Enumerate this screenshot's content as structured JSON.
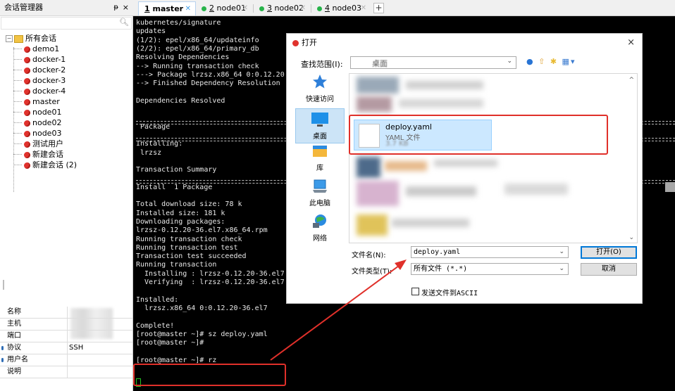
{
  "sidebar": {
    "title": "会话管理器",
    "pin_label": "ᵽ",
    "close_label": "×",
    "root": "所有会话",
    "sessions": [
      "demo1",
      "docker-1",
      "docker-2",
      "docker-3",
      "docker-4",
      "master",
      "node01",
      "node02",
      "node03",
      "测试用户",
      "新建会话",
      "新建会话 (2)"
    ],
    "properties": [
      {
        "key": "名称",
        "value": ""
      },
      {
        "key": "主机",
        "value": ""
      },
      {
        "key": "端口",
        "value": ""
      },
      {
        "key": "协议",
        "value": "SSH"
      },
      {
        "key": "用户名",
        "value": ""
      },
      {
        "key": "说明",
        "value": ""
      }
    ]
  },
  "tabs": [
    {
      "num": "1",
      "name": "master",
      "active": true
    },
    {
      "num": "2",
      "name": "node01",
      "active": false
    },
    {
      "num": "3",
      "name": "node02",
      "active": false
    },
    {
      "num": "4",
      "name": "node03",
      "active": false
    }
  ],
  "tab_add": "+",
  "terminal": {
    "lines": [
      "kubernetes/signature",
      "updates",
      "(1/2): epel/x86_64/updateinfo",
      "(2/2): epel/x86_64/primary_db",
      "Resolving Dependencies",
      "--> Running transaction check",
      "---> Package lrzsz.x86_64 0:0.12.20",
      "--> Finished Dependency Resolution",
      "",
      "Dependencies Resolved",
      "",
      "",
      " Package",
      "",
      "Installing:",
      " lrzsz",
      "",
      "Transaction Summary",
      "",
      "Install  1 Package",
      "",
      "Total download size: 78 k",
      "Installed size: 181 k",
      "Downloading packages:",
      "lrzsz-0.12.20-36.el7.x86_64.rpm",
      "Running transaction check",
      "Running transaction test",
      "Transaction test succeeded",
      "Running transaction",
      "  Installing : lrzsz-0.12.20-36.el7",
      "  Verifying  : lrzsz-0.12.20-36.el7",
      "",
      "Installed:",
      "  lrzsz.x86_64 0:0.12.20-36.el7",
      "",
      "Complete!",
      "[root@master ~]# sz deploy.yaml",
      "[root@master ~]#",
      "",
      "[root@master ~]# rz"
    ]
  },
  "dialog": {
    "title": "打开",
    "close_label": "×",
    "look_in_label": "查找范围(I):",
    "look_in_value": "桌面",
    "places": [
      "快速访问",
      "桌面",
      "库",
      "此电脑",
      "网络"
    ],
    "file": {
      "name": "deploy.yaml",
      "type": "YAML 文件",
      "size": "3.7 KB"
    },
    "filename_label": "文件名(N):",
    "filename_value": "deploy.yaml",
    "filetype_label": "文件类型(T):",
    "filetype_value": "所有文件 (*.*)",
    "open_button": "打开(O)",
    "cancel_button": "取消",
    "ascii_label": "发送文件到ASCII"
  },
  "colors": {
    "highlight_box": "#e0302a",
    "terminal_bg": "#000000",
    "selection": "#cce8ff"
  }
}
